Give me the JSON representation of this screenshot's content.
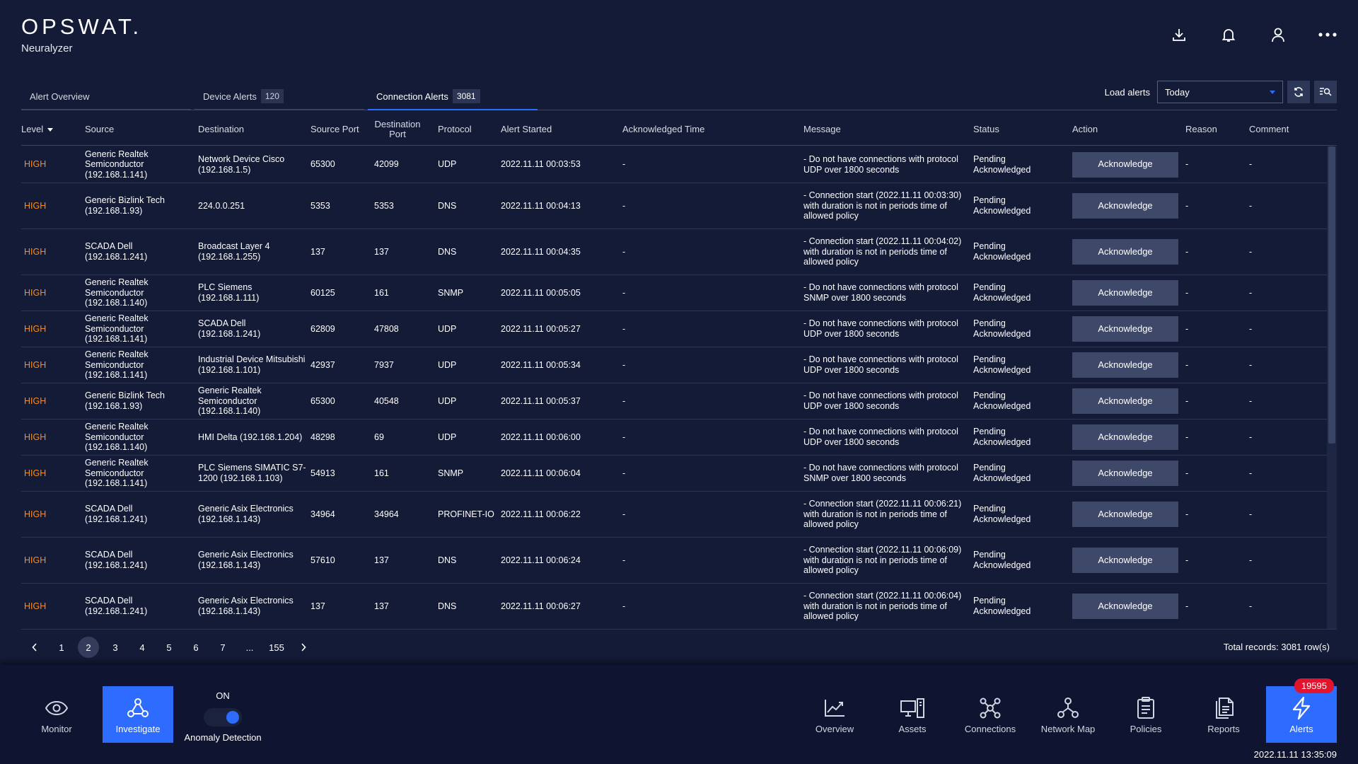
{
  "brand": {
    "logo": "OPSWAT.",
    "product": "Neuralyzer"
  },
  "header_icons": [
    "download-icon",
    "bell-icon",
    "user-icon",
    "more-icon"
  ],
  "tabs": [
    {
      "label": "Alert Overview",
      "count": ""
    },
    {
      "label": "Device Alerts",
      "count": "120"
    },
    {
      "label": "Connection Alerts",
      "count": "3081"
    }
  ],
  "load_alerts": {
    "label": "Load alerts",
    "value": "Today"
  },
  "columns": [
    "Level",
    "Source",
    "Destination",
    "Source Port",
    "Destination Port",
    "Protocol",
    "Alert Started",
    "Acknowledged Time",
    "Message",
    "Status",
    "Action",
    "Reason",
    "Comment"
  ],
  "rows": [
    {
      "level": "HIGH",
      "source": "Generic Realtek Semiconductor (192.168.1.141)",
      "destination": "Network Device Cisco (192.168.1.5)",
      "source_port": "65300",
      "destination_port": "42099",
      "protocol": "UDP",
      "alert_started": "2022.11.11 00:03:53",
      "ack_time": "-",
      "message": "- Do not have connections with protocol UDP over 1800 seconds",
      "status": "Pending Acknowledged",
      "action": "Acknowledge",
      "reason": "-",
      "comment": "-"
    },
    {
      "level": "HIGH",
      "source": "Generic Bizlink Tech (192.168.1.93)",
      "destination": "224.0.0.251",
      "source_port": "5353",
      "destination_port": "5353",
      "protocol": "DNS",
      "alert_started": "2022.11.11 00:04:13",
      "ack_time": "-",
      "message": "- Connection start (2022.11.11 00:03:30) with duration is not in periods time of allowed policy",
      "status": "Pending Acknowledged",
      "action": "Acknowledge",
      "reason": "-",
      "comment": "-"
    },
    {
      "level": "HIGH",
      "source": "SCADA Dell (192.168.1.241)",
      "destination": "Broadcast Layer 4 (192.168.1.255)",
      "source_port": "137",
      "destination_port": "137",
      "protocol": "DNS",
      "alert_started": "2022.11.11 00:04:35",
      "ack_time": "-",
      "message": "- Connection start (2022.11.11 00:04:02) with duration is not in periods time of allowed policy",
      "status": "Pending Acknowledged",
      "action": "Acknowledge",
      "reason": "-",
      "comment": "-"
    },
    {
      "level": "HIGH",
      "source": "Generic Realtek Semiconductor (192.168.1.140)",
      "destination": "PLC Siemens (192.168.1.111)",
      "source_port": "60125",
      "destination_port": "161",
      "protocol": "SNMP",
      "alert_started": "2022.11.11 00:05:05",
      "ack_time": "-",
      "message": "- Do not have connections with protocol SNMP over 1800 seconds",
      "status": "Pending Acknowledged",
      "action": "Acknowledge",
      "reason": "-",
      "comment": "-"
    },
    {
      "level": "HIGH",
      "source": "Generic Realtek Semiconductor (192.168.1.141)",
      "destination": "SCADA Dell (192.168.1.241)",
      "source_port": "62809",
      "destination_port": "47808",
      "protocol": "UDP",
      "alert_started": "2022.11.11 00:05:27",
      "ack_time": "-",
      "message": "- Do not have connections with protocol UDP over 1800 seconds",
      "status": "Pending Acknowledged",
      "action": "Acknowledge",
      "reason": "-",
      "comment": "-"
    },
    {
      "level": "HIGH",
      "source": "Generic Realtek Semiconductor (192.168.1.141)",
      "destination": "Industrial Device Mitsubishi (192.168.1.101)",
      "source_port": "42937",
      "destination_port": "7937",
      "protocol": "UDP",
      "alert_started": "2022.11.11 00:05:34",
      "ack_time": "-",
      "message": "- Do not have connections with protocol UDP over 1800 seconds",
      "status": "Pending Acknowledged",
      "action": "Acknowledge",
      "reason": "-",
      "comment": "-"
    },
    {
      "level": "HIGH",
      "source": "Generic Bizlink Tech (192.168.1.93)",
      "destination": "Generic Realtek Semiconductor (192.168.1.140)",
      "source_port": "65300",
      "destination_port": "40548",
      "protocol": "UDP",
      "alert_started": "2022.11.11 00:05:37",
      "ack_time": "-",
      "message": "- Do not have connections with protocol UDP over 1800 seconds",
      "status": "Pending Acknowledged",
      "action": "Acknowledge",
      "reason": "-",
      "comment": "-"
    },
    {
      "level": "HIGH",
      "source": "Generic Realtek Semiconductor (192.168.1.140)",
      "destination": "HMI Delta (192.168.1.204)",
      "source_port": "48298",
      "destination_port": "69",
      "protocol": "UDP",
      "alert_started": "2022.11.11 00:06:00",
      "ack_time": "-",
      "message": "- Do not have connections with protocol UDP over 1800 seconds",
      "status": "Pending Acknowledged",
      "action": "Acknowledge",
      "reason": "-",
      "comment": "-"
    },
    {
      "level": "HIGH",
      "source": "Generic Realtek Semiconductor (192.168.1.141)",
      "destination": "PLC Siemens SIMATIC S7-1200 (192.168.1.103)",
      "source_port": "54913",
      "destination_port": "161",
      "protocol": "SNMP",
      "alert_started": "2022.11.11 00:06:04",
      "ack_time": "-",
      "message": "- Do not have connections with protocol SNMP over 1800 seconds",
      "status": "Pending Acknowledged",
      "action": "Acknowledge",
      "reason": "-",
      "comment": "-"
    },
    {
      "level": "HIGH",
      "source": "SCADA Dell (192.168.1.241)",
      "destination": "Generic Asix Electronics (192.168.1.143)",
      "source_port": "34964",
      "destination_port": "34964",
      "protocol": "PROFINET-IO",
      "alert_started": "2022.11.11 00:06:22",
      "ack_time": "-",
      "message": "- Connection start (2022.11.11 00:06:21) with duration is not in periods time of allowed policy",
      "status": "Pending Acknowledged",
      "action": "Acknowledge",
      "reason": "-",
      "comment": "-"
    },
    {
      "level": "HIGH",
      "source": "SCADA Dell (192.168.1.241)",
      "destination": "Generic Asix Electronics (192.168.1.143)",
      "source_port": "57610",
      "destination_port": "137",
      "protocol": "DNS",
      "alert_started": "2022.11.11 00:06:24",
      "ack_time": "-",
      "message": "- Connection start (2022.11.11 00:06:09) with duration is not in periods time of allowed policy",
      "status": "Pending Acknowledged",
      "action": "Acknowledge",
      "reason": "-",
      "comment": "-"
    },
    {
      "level": "HIGH",
      "source": "SCADA Dell (192.168.1.241)",
      "destination": "Generic Asix Electronics (192.168.1.143)",
      "source_port": "137",
      "destination_port": "137",
      "protocol": "DNS",
      "alert_started": "2022.11.11 00:06:27",
      "ack_time": "-",
      "message": "- Connection start (2022.11.11 00:06:04) with duration is not in periods time of allowed policy",
      "status": "Pending Acknowledged",
      "action": "Acknowledge",
      "reason": "-",
      "comment": "-"
    }
  ],
  "pagination": {
    "pages": [
      "1",
      "2",
      "3",
      "4",
      "5",
      "6",
      "7",
      "...",
      "155"
    ],
    "current": "2",
    "total": "Total records: 3081 row(s)"
  },
  "bottom_nav": {
    "left": [
      {
        "label": "Monitor",
        "icon": "eye-icon"
      },
      {
        "label": "Investigate",
        "icon": "investigate-icon"
      }
    ],
    "anomaly": {
      "state": "ON",
      "label": "Anomaly Detection"
    },
    "right": [
      {
        "label": "Overview",
        "icon": "chart-icon"
      },
      {
        "label": "Assets",
        "icon": "assets-icon"
      },
      {
        "label": "Connections",
        "icon": "connections-icon"
      },
      {
        "label": "Network Map",
        "icon": "network-map-icon"
      },
      {
        "label": "Policies",
        "icon": "policies-icon"
      },
      {
        "label": "Reports",
        "icon": "reports-icon"
      },
      {
        "label": "Alerts",
        "icon": "alerts-icon"
      }
    ],
    "alerts_badge": "19595"
  },
  "clock": "2022.11.11 13:35:09",
  "colors": {
    "background": "#131b36",
    "accent": "#2e6bff",
    "level_high": "#ff8a1a",
    "badge": "#e0142c"
  }
}
